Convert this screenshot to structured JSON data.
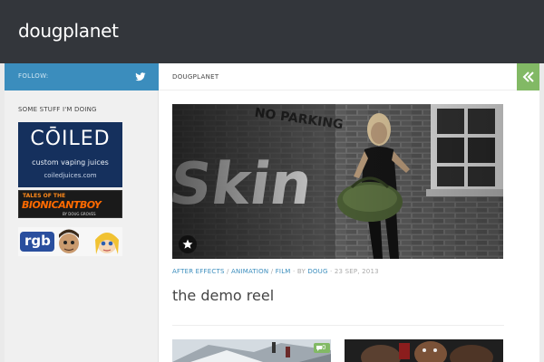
{
  "site": {
    "title": "dougplanet"
  },
  "sidebar": {
    "follow_label": "FOLLOW:",
    "widget_title": "SOME STUFF I'M DOING",
    "ads": {
      "coiled": {
        "logo": "CŌILED",
        "tagline": "custom vaping juices",
        "url": "coiledjuices.com"
      },
      "bionic": {
        "top": "TALES OF THE",
        "main": "BIONICANTBOY",
        "byline": "BY DOUG GROVES"
      },
      "rgb": {
        "text": "rgb"
      }
    }
  },
  "breadcrumb": {
    "label": "DOUGPLANET"
  },
  "post": {
    "categories": [
      "AFTER EFFECTS",
      "ANIMATION",
      "FILM"
    ],
    "separator": " / ",
    "by_label": " · BY ",
    "author": "DOUG",
    "date": " · 23 SEP, 2013",
    "title": "the demo reel"
  },
  "next_posts": {
    "comment_count": "0"
  },
  "icons": {
    "twitter": "twitter-icon",
    "collapse": "double-chevron-left-icon",
    "featured": "star-icon",
    "comments": "comment-icon"
  },
  "colors": {
    "header": "#33363b",
    "follow_bar": "#3b8dbd",
    "accent_green": "#82b965",
    "link_blue": "#3b8dbd"
  }
}
